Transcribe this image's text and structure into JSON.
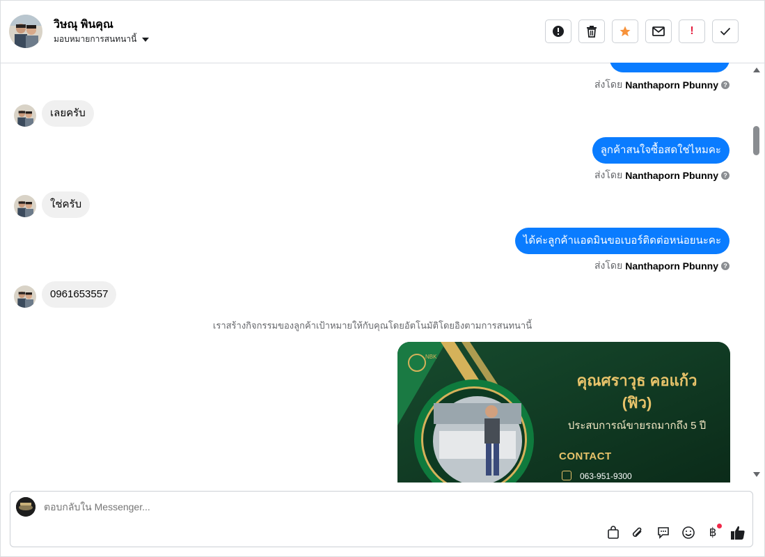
{
  "header": {
    "name": "วิษณุ พินคุณ",
    "assign_label": "มอบหมายการสนทนานี้",
    "buttons": {
      "spam": "!",
      "delete": "trash",
      "star": "star",
      "mark_unread": "envelope",
      "follow_up": "!",
      "done": "check"
    },
    "colors": {
      "star": "#f7923a",
      "alert": "#e41e3f"
    }
  },
  "messages": {
    "partial_out_sender_prefix": "ส่งโดย",
    "partial_out_sender": "Nanthaporn Pbunny",
    "in_1": "เลยครับ",
    "out_1": "ลูกค้าสนใจซื้อสดใช่ไหมคะ",
    "out_1_sender_prefix": "ส่งโดย",
    "out_1_sender": "Nanthaporn Pbunny",
    "in_2": "ใช่ครับ",
    "out_2": "ได้ค่ะลูกค้าแอดมินขอเบอร์ติดต่อหน่อยนะคะ",
    "out_2_sender_prefix": "ส่งโดย",
    "out_2_sender": "Nanthaporn Pbunny",
    "in_3": "0961653557",
    "system_note": "เราสร้างกิจกรรมของลูกค้าเป้าหมายให้กับคุณโดยอัตโนมัติโดยอิงตามการสนทนานี้",
    "bubble_color": "#0a7cff"
  },
  "card": {
    "name_line1": "คุณศราวุธ คอแก้ว",
    "name_line2": "(ฟิว)",
    "experience": "ประสบการณ์ขายรถมากถึง 5 ปี",
    "contact_label": "CONTACT",
    "phone": "063-951-9300"
  },
  "composer": {
    "placeholder": "ตอบกลับใน Messenger...",
    "tools": [
      "shopping-bag-icon",
      "paperclip-icon",
      "saved-reply-icon",
      "emoji-icon",
      "baht-icon",
      "like-icon"
    ]
  }
}
